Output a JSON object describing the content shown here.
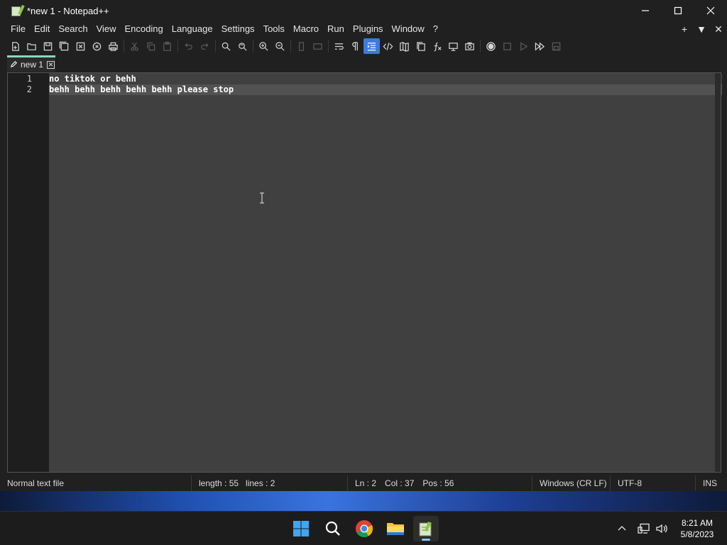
{
  "window": {
    "title": "*new 1 - Notepad++"
  },
  "menu": {
    "items": [
      "File",
      "Edit",
      "Search",
      "View",
      "Encoding",
      "Language",
      "Settings",
      "Tools",
      "Macro",
      "Run",
      "Plugins",
      "Window",
      "?"
    ],
    "right": [
      "+",
      "▼",
      "✕"
    ]
  },
  "tabs": [
    {
      "label": "new 1",
      "close": "✕"
    }
  ],
  "editor": {
    "lines": [
      {
        "number": "1",
        "text": "no tiktok or behh"
      },
      {
        "number": "2",
        "text": "behh behh behh behh behh please stop"
      }
    ],
    "current_line": 2
  },
  "status": {
    "file_type": "Normal text file",
    "length": "length : 55",
    "lines": "lines : 2",
    "ln": "Ln : 2",
    "col": "Col : 37",
    "pos": "Pos : 56",
    "eol": "Windows (CR LF)",
    "encoding": "UTF-8",
    "mode": "INS"
  },
  "taskbar": {
    "time": "8:21 AM",
    "date": "5/8/2023",
    "apps": [
      "windows-start-icon",
      "search-icon",
      "chrome-icon",
      "file-explorer-icon",
      "notepadpp-icon"
    ]
  },
  "colors": {
    "accent": "#3d7bd9",
    "tab_accent": "#8fd3c0",
    "editor_bg": "#404040",
    "current_line_bg": "#525252"
  }
}
